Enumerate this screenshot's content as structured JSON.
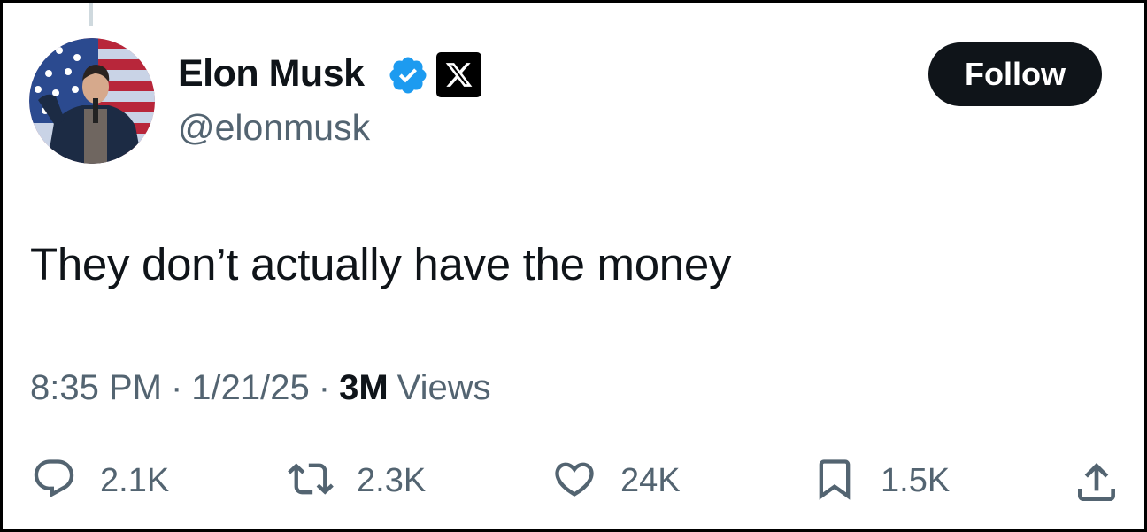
{
  "author": {
    "display_name": "Elon Musk",
    "handle": "@elonmusk",
    "verified_badge_icon": "verified-badge-icon",
    "affiliation_badge_icon": "x-logo-icon",
    "verified_color": "#1d9bf0"
  },
  "follow_button": {
    "label": "Follow"
  },
  "tweet": {
    "text": "They don’t actually have the money",
    "time": "8:35 PM",
    "date": "1/21/25",
    "separator": "·",
    "views_count": "3M",
    "views_label": "Views"
  },
  "actions": {
    "replies": {
      "icon": "reply-icon",
      "count": "2.1K"
    },
    "reposts": {
      "icon": "repost-icon",
      "count": "2.3K"
    },
    "likes": {
      "icon": "heart-icon",
      "count": "24K"
    },
    "bookmarks": {
      "icon": "bookmark-icon",
      "count": "1.5K"
    },
    "share": {
      "icon": "share-icon"
    }
  },
  "colors": {
    "text_primary": "#0f1419",
    "text_secondary": "#536471",
    "button_bg": "#0f1419",
    "button_text": "#ffffff"
  }
}
